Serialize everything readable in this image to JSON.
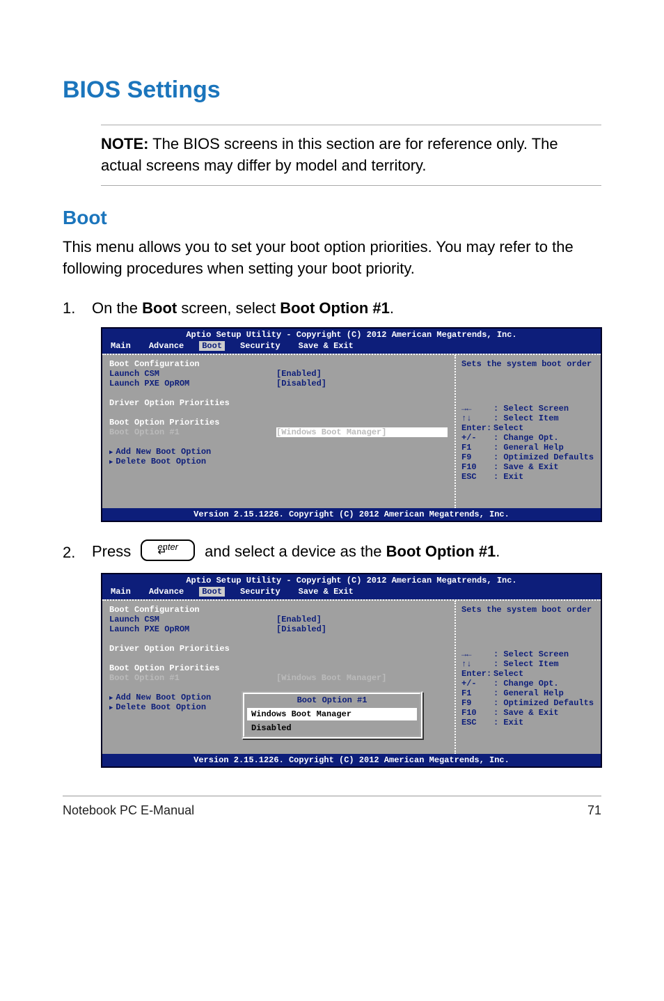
{
  "page": {
    "heading": "BIOS Settings",
    "note_label": "NOTE:",
    "note_text": " The BIOS screens in this section are for reference only. The actual screens may differ by model and territory.",
    "sub_heading": "Boot",
    "boot_desc": "This menu allows you to set your boot option priorities. You may refer to the following procedures when setting your boot priority.",
    "step1_num": "1.",
    "step1_a": "On the ",
    "step1_b": "Boot",
    "step1_c": " screen, select ",
    "step1_d": "Boot Option #1",
    "step1_e": ".",
    "step2_num": "2.",
    "step2_a": "Press",
    "step2_key": "enter",
    "step2_b": "and select a device as the ",
    "step2_c": "Boot Option #1",
    "step2_d": ".",
    "footer_left": "Notebook PC E-Manual",
    "footer_right": "71"
  },
  "bios": {
    "title": "Aptio Setup Utility - Copyright (C) 2012 American Megatrends, Inc.",
    "tabs": [
      "Main",
      "Advance",
      "Boot",
      "Security",
      "Save & Exit"
    ],
    "boot_config": "Boot Configuration",
    "launch_csm": "Launch CSM",
    "launch_csm_val": "[Enabled]",
    "launch_pxe": "Launch PXE OpROM",
    "launch_pxe_val": "[Disabled]",
    "driver_prio": "Driver Option Priorities",
    "boot_prio": "Boot Option Priorities",
    "boot_opt1": "Boot Option #1",
    "boot_opt1_val": "[Windows Boot Manager]",
    "add_new": "Add New Boot Option",
    "delete": "Delete Boot Option",
    "help": "Sets the system boot order",
    "keys": [
      {
        "k": "→←",
        "d": ": Select Screen"
      },
      {
        "k": "↑↓",
        "d": ": Select Item"
      },
      {
        "k": "Enter:",
        "d": "Select"
      },
      {
        "k": "+/-",
        "d": ": Change Opt."
      },
      {
        "k": "F1",
        "d": ": General Help"
      },
      {
        "k": "F9",
        "d": ": Optimized Defaults"
      },
      {
        "k": "F10",
        "d": ": Save & Exit"
      },
      {
        "k": "ESC",
        "d": ": Exit"
      }
    ],
    "version": "Version 2.15.1226. Copyright (C) 2012 American Megatrends, Inc.",
    "popup_title": "Boot Option #1",
    "popup_sel": "Windows Boot Manager",
    "popup_disabled": "Disabled"
  }
}
